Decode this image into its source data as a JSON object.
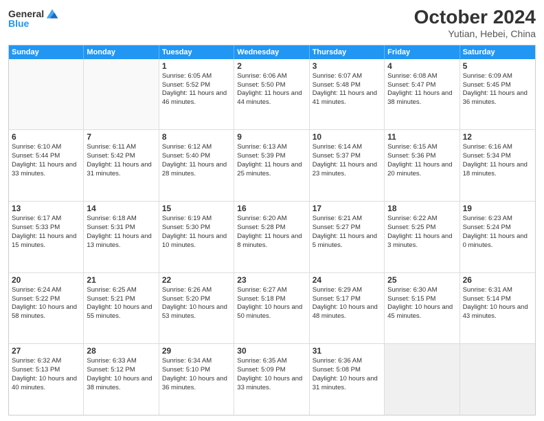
{
  "header": {
    "logo_general": "General",
    "logo_blue": "Blue",
    "title": "October 2024",
    "subtitle": "Yutian, Hebei, China"
  },
  "weekdays": [
    "Sunday",
    "Monday",
    "Tuesday",
    "Wednesday",
    "Thursday",
    "Friday",
    "Saturday"
  ],
  "weeks": [
    [
      {
        "day": "",
        "sunrise": "",
        "sunset": "",
        "daylight": "",
        "empty": true
      },
      {
        "day": "",
        "sunrise": "",
        "sunset": "",
        "daylight": "",
        "empty": true
      },
      {
        "day": "1",
        "sunrise": "Sunrise: 6:05 AM",
        "sunset": "Sunset: 5:52 PM",
        "daylight": "Daylight: 11 hours and 46 minutes.",
        "empty": false
      },
      {
        "day": "2",
        "sunrise": "Sunrise: 6:06 AM",
        "sunset": "Sunset: 5:50 PM",
        "daylight": "Daylight: 11 hours and 44 minutes.",
        "empty": false
      },
      {
        "day": "3",
        "sunrise": "Sunrise: 6:07 AM",
        "sunset": "Sunset: 5:48 PM",
        "daylight": "Daylight: 11 hours and 41 minutes.",
        "empty": false
      },
      {
        "day": "4",
        "sunrise": "Sunrise: 6:08 AM",
        "sunset": "Sunset: 5:47 PM",
        "daylight": "Daylight: 11 hours and 38 minutes.",
        "empty": false
      },
      {
        "day": "5",
        "sunrise": "Sunrise: 6:09 AM",
        "sunset": "Sunset: 5:45 PM",
        "daylight": "Daylight: 11 hours and 36 minutes.",
        "empty": false
      }
    ],
    [
      {
        "day": "6",
        "sunrise": "Sunrise: 6:10 AM",
        "sunset": "Sunset: 5:44 PM",
        "daylight": "Daylight: 11 hours and 33 minutes.",
        "empty": false
      },
      {
        "day": "7",
        "sunrise": "Sunrise: 6:11 AM",
        "sunset": "Sunset: 5:42 PM",
        "daylight": "Daylight: 11 hours and 31 minutes.",
        "empty": false
      },
      {
        "day": "8",
        "sunrise": "Sunrise: 6:12 AM",
        "sunset": "Sunset: 5:40 PM",
        "daylight": "Daylight: 11 hours and 28 minutes.",
        "empty": false
      },
      {
        "day": "9",
        "sunrise": "Sunrise: 6:13 AM",
        "sunset": "Sunset: 5:39 PM",
        "daylight": "Daylight: 11 hours and 25 minutes.",
        "empty": false
      },
      {
        "day": "10",
        "sunrise": "Sunrise: 6:14 AM",
        "sunset": "Sunset: 5:37 PM",
        "daylight": "Daylight: 11 hours and 23 minutes.",
        "empty": false
      },
      {
        "day": "11",
        "sunrise": "Sunrise: 6:15 AM",
        "sunset": "Sunset: 5:36 PM",
        "daylight": "Daylight: 11 hours and 20 minutes.",
        "empty": false
      },
      {
        "day": "12",
        "sunrise": "Sunrise: 6:16 AM",
        "sunset": "Sunset: 5:34 PM",
        "daylight": "Daylight: 11 hours and 18 minutes.",
        "empty": false
      }
    ],
    [
      {
        "day": "13",
        "sunrise": "Sunrise: 6:17 AM",
        "sunset": "Sunset: 5:33 PM",
        "daylight": "Daylight: 11 hours and 15 minutes.",
        "empty": false
      },
      {
        "day": "14",
        "sunrise": "Sunrise: 6:18 AM",
        "sunset": "Sunset: 5:31 PM",
        "daylight": "Daylight: 11 hours and 13 minutes.",
        "empty": false
      },
      {
        "day": "15",
        "sunrise": "Sunrise: 6:19 AM",
        "sunset": "Sunset: 5:30 PM",
        "daylight": "Daylight: 11 hours and 10 minutes.",
        "empty": false
      },
      {
        "day": "16",
        "sunrise": "Sunrise: 6:20 AM",
        "sunset": "Sunset: 5:28 PM",
        "daylight": "Daylight: 11 hours and 8 minutes.",
        "empty": false
      },
      {
        "day": "17",
        "sunrise": "Sunrise: 6:21 AM",
        "sunset": "Sunset: 5:27 PM",
        "daylight": "Daylight: 11 hours and 5 minutes.",
        "empty": false
      },
      {
        "day": "18",
        "sunrise": "Sunrise: 6:22 AM",
        "sunset": "Sunset: 5:25 PM",
        "daylight": "Daylight: 11 hours and 3 minutes.",
        "empty": false
      },
      {
        "day": "19",
        "sunrise": "Sunrise: 6:23 AM",
        "sunset": "Sunset: 5:24 PM",
        "daylight": "Daylight: 11 hours and 0 minutes.",
        "empty": false
      }
    ],
    [
      {
        "day": "20",
        "sunrise": "Sunrise: 6:24 AM",
        "sunset": "Sunset: 5:22 PM",
        "daylight": "Daylight: 10 hours and 58 minutes.",
        "empty": false
      },
      {
        "day": "21",
        "sunrise": "Sunrise: 6:25 AM",
        "sunset": "Sunset: 5:21 PM",
        "daylight": "Daylight: 10 hours and 55 minutes.",
        "empty": false
      },
      {
        "day": "22",
        "sunrise": "Sunrise: 6:26 AM",
        "sunset": "Sunset: 5:20 PM",
        "daylight": "Daylight: 10 hours and 53 minutes.",
        "empty": false
      },
      {
        "day": "23",
        "sunrise": "Sunrise: 6:27 AM",
        "sunset": "Sunset: 5:18 PM",
        "daylight": "Daylight: 10 hours and 50 minutes.",
        "empty": false
      },
      {
        "day": "24",
        "sunrise": "Sunrise: 6:29 AM",
        "sunset": "Sunset: 5:17 PM",
        "daylight": "Daylight: 10 hours and 48 minutes.",
        "empty": false
      },
      {
        "day": "25",
        "sunrise": "Sunrise: 6:30 AM",
        "sunset": "Sunset: 5:15 PM",
        "daylight": "Daylight: 10 hours and 45 minutes.",
        "empty": false
      },
      {
        "day": "26",
        "sunrise": "Sunrise: 6:31 AM",
        "sunset": "Sunset: 5:14 PM",
        "daylight": "Daylight: 10 hours and 43 minutes.",
        "empty": false
      }
    ],
    [
      {
        "day": "27",
        "sunrise": "Sunrise: 6:32 AM",
        "sunset": "Sunset: 5:13 PM",
        "daylight": "Daylight: 10 hours and 40 minutes.",
        "empty": false
      },
      {
        "day": "28",
        "sunrise": "Sunrise: 6:33 AM",
        "sunset": "Sunset: 5:12 PM",
        "daylight": "Daylight: 10 hours and 38 minutes.",
        "empty": false
      },
      {
        "day": "29",
        "sunrise": "Sunrise: 6:34 AM",
        "sunset": "Sunset: 5:10 PM",
        "daylight": "Daylight: 10 hours and 36 minutes.",
        "empty": false
      },
      {
        "day": "30",
        "sunrise": "Sunrise: 6:35 AM",
        "sunset": "Sunset: 5:09 PM",
        "daylight": "Daylight: 10 hours and 33 minutes.",
        "empty": false
      },
      {
        "day": "31",
        "sunrise": "Sunrise: 6:36 AM",
        "sunset": "Sunset: 5:08 PM",
        "daylight": "Daylight: 10 hours and 31 minutes.",
        "empty": false
      },
      {
        "day": "",
        "sunrise": "",
        "sunset": "",
        "daylight": "",
        "empty": true
      },
      {
        "day": "",
        "sunrise": "",
        "sunset": "",
        "daylight": "",
        "empty": true
      }
    ]
  ]
}
